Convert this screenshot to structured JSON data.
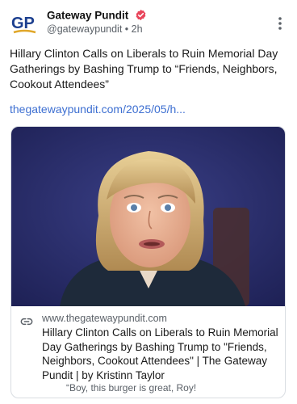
{
  "post": {
    "author": {
      "display_name": "Gateway Pundit",
      "handle": "@gatewaypundit",
      "separator": "•",
      "time": "2h",
      "avatar_text": "GP",
      "verified": true
    },
    "text": "Hillary Clinton Calls on Liberals to Ruin Memorial Day Gatherings by Bashing Trump to “Friends, Neighbors, Cookout Attendees”",
    "link_text": "thegatewaypundit.com/2025/05/h...",
    "card": {
      "domain": "www.thegatewaypundit.com",
      "title": "Hillary Clinton Calls on Liberals to Ruin Memorial Day Gatherings by Bashing Trump to \"Friends, Neighbors, Cookout Attendees\" | The Gateway Pundit | by Kristinn Taylor",
      "description": "“Boy, this burger is great, Roy!"
    }
  },
  "icons": {
    "more": "more-vertical-icon",
    "verified": "verified-badge-icon",
    "link": "link-icon"
  },
  "colors": {
    "logo_blue": "#1c3f8f",
    "logo_gold": "#e0a72a",
    "verified": "#e8445a",
    "link": "#3d6fd1",
    "muted": "#5b6168"
  }
}
